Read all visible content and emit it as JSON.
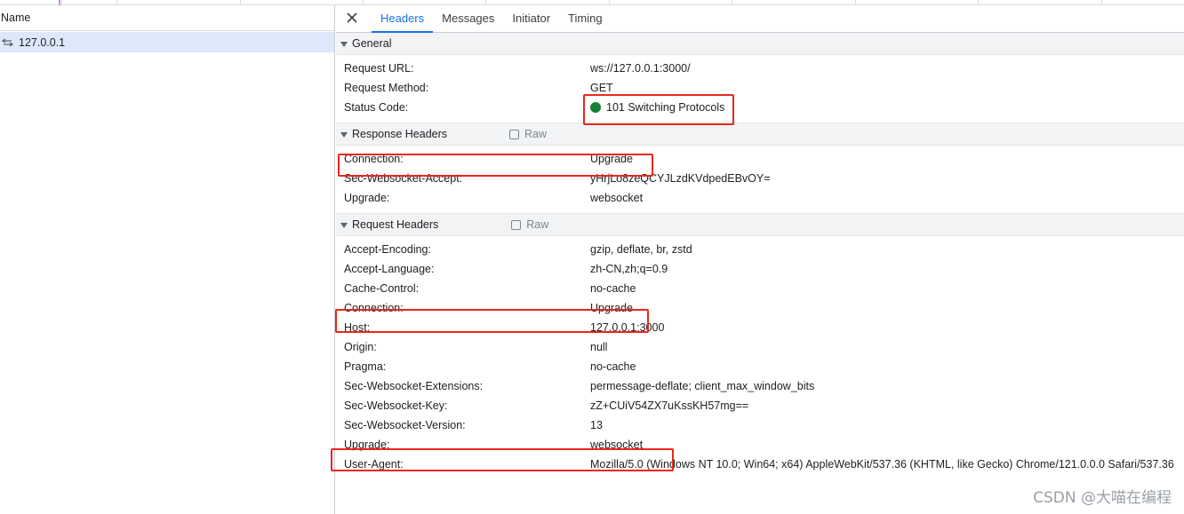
{
  "list": {
    "header_name": "Name",
    "request_label": "127.0.0.1"
  },
  "tabs": [
    {
      "label": "Headers",
      "active": true
    },
    {
      "label": "Messages",
      "active": false
    },
    {
      "label": "Initiator",
      "active": false
    },
    {
      "label": "Timing",
      "active": false
    }
  ],
  "general": {
    "title": "General",
    "rows": [
      {
        "key": "Request URL:",
        "value": "ws://127.0.0.1:3000/"
      },
      {
        "key": "Request Method:",
        "value": "GET"
      },
      {
        "key": "Status Code:",
        "value": "101 Switching Protocols"
      }
    ]
  },
  "response_headers": {
    "title": "Response Headers",
    "raw_label": "Raw",
    "rows": [
      {
        "key": "Connection:",
        "value": "Upgrade"
      },
      {
        "key": "Sec-Websocket-Accept:",
        "value": "yHrjLo8zeQCYJLzdKVdpedEBvOY="
      },
      {
        "key": "Upgrade:",
        "value": "websocket"
      }
    ]
  },
  "request_headers": {
    "title": "Request Headers",
    "raw_label": "Raw",
    "rows": [
      {
        "key": "Accept-Encoding:",
        "value": "gzip, deflate, br, zstd"
      },
      {
        "key": "Accept-Language:",
        "value": "zh-CN,zh;q=0.9"
      },
      {
        "key": "Cache-Control:",
        "value": "no-cache"
      },
      {
        "key": "Connection:",
        "value": "Upgrade"
      },
      {
        "key": "Host:",
        "value": "127.0.0.1:3000"
      },
      {
        "key": "Origin:",
        "value": "null"
      },
      {
        "key": "Pragma:",
        "value": "no-cache"
      },
      {
        "key": "Sec-Websocket-Extensions:",
        "value": "permessage-deflate; client_max_window_bits"
      },
      {
        "key": "Sec-Websocket-Key:",
        "value": "zZ+CUiV54ZX7uKssKH57mg=="
      },
      {
        "key": "Sec-Websocket-Version:",
        "value": "13"
      },
      {
        "key": "Upgrade:",
        "value": "websocket"
      },
      {
        "key": "User-Agent:",
        "value": "Mozilla/5.0 (Windows NT 10.0; Win64; x64) AppleWebKit/537.36 (KHTML, like Gecko) Chrome/121.0.0.0 Safari/537.36"
      }
    ]
  },
  "watermark": "CSDN @大喵在编程",
  "colors": {
    "accent": "#1a73e8",
    "status_ok": "#188038",
    "highlight": "#e8271f",
    "selected_row": "#dee8fb"
  }
}
